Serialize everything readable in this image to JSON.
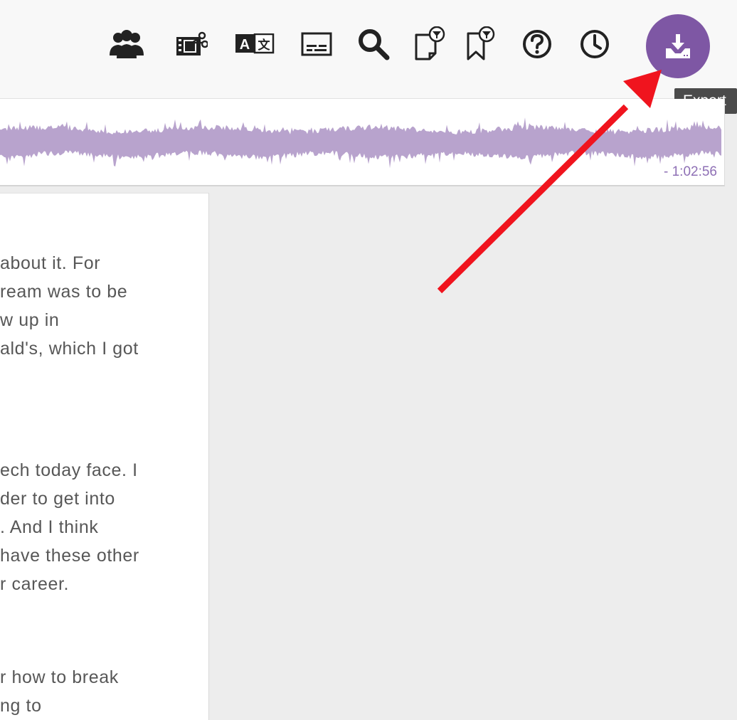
{
  "toolbar": {
    "icons": [
      {
        "name": "speakers-icon",
        "label": ""
      },
      {
        "name": "video-editor-icon",
        "label": ""
      },
      {
        "name": "translate-icon",
        "label": ""
      },
      {
        "name": "subtitles-icon",
        "label": ""
      },
      {
        "name": "search-icon",
        "label": ""
      },
      {
        "name": "filter-notes-icon",
        "label": ""
      },
      {
        "name": "filter-bookmarks-icon",
        "label": ""
      },
      {
        "name": "help-icon",
        "label": ""
      },
      {
        "name": "history-icon",
        "label": ""
      }
    ],
    "export": {
      "icon": "download-icon",
      "tooltip": "Export",
      "color": "#7e57a4"
    }
  },
  "waveform": {
    "time_remaining": "- 1:02:56",
    "color": "#b8a3cd"
  },
  "transcript": {
    "paragraphs": [
      {
        "lines": [
          "about it. For",
          "ream was to be",
          "w up in",
          "ald's, which I got"
        ]
      },
      {
        "lines": [
          "ech today face. I",
          "der to get into",
          ". And I think",
          "have these other",
          "r career."
        ]
      },
      {
        "lines": [
          "r how to break",
          "ng to"
        ]
      }
    ]
  },
  "annotation": {
    "arrow_color": "#f0141e"
  }
}
